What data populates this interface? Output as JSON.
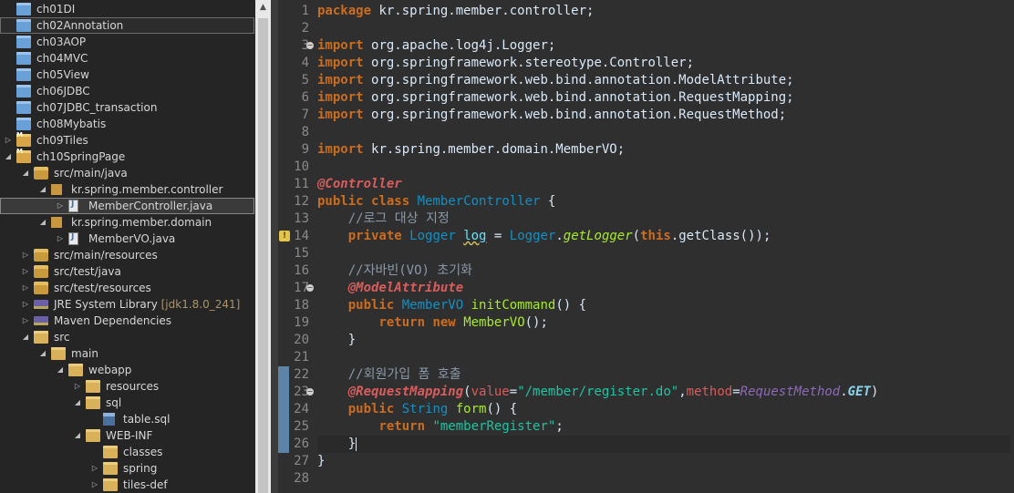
{
  "explorer": {
    "items": [
      {
        "label": "ch01DI",
        "level": 1,
        "icon": "project-folder-icon",
        "expanded": null
      },
      {
        "label": "ch02Annotation",
        "level": 1,
        "icon": "project-folder-icon",
        "expanded": null,
        "boxed": true
      },
      {
        "label": "ch03AOP",
        "level": 1,
        "icon": "project-folder-icon",
        "expanded": null
      },
      {
        "label": "ch04MVC",
        "level": 1,
        "icon": "project-folder-icon",
        "expanded": null
      },
      {
        "label": "ch05View",
        "level": 1,
        "icon": "project-folder-icon",
        "expanded": null
      },
      {
        "label": "ch06JDBC",
        "level": 1,
        "icon": "project-folder-icon",
        "expanded": null
      },
      {
        "label": "ch07JDBC_transaction",
        "level": 1,
        "icon": "project-folder-icon",
        "expanded": null
      },
      {
        "label": "ch08Mybatis",
        "level": 1,
        "icon": "project-folder-icon",
        "expanded": null
      },
      {
        "label": "ch09Tiles",
        "level": 1,
        "icon": "maven-project-icon",
        "expanded": false
      },
      {
        "label": "ch10SpringPage",
        "level": 1,
        "icon": "maven-project-icon",
        "expanded": true
      },
      {
        "label": "src/main/java",
        "level": 2,
        "icon": "source-folder-icon",
        "expanded": true
      },
      {
        "label": "kr.spring.member.controller",
        "level": 3,
        "icon": "package-icon",
        "expanded": true
      },
      {
        "label": "MemberController.java",
        "level": 4,
        "icon": "java-file-icon",
        "expanded": false,
        "selected": true
      },
      {
        "label": "kr.spring.member.domain",
        "level": 3,
        "icon": "package-icon",
        "expanded": true
      },
      {
        "label": "MemberVO.java",
        "level": 4,
        "icon": "java-file-icon",
        "expanded": false
      },
      {
        "label": "src/main/resources",
        "level": 2,
        "icon": "source-folder-icon",
        "expanded": false
      },
      {
        "label": "src/test/java",
        "level": 2,
        "icon": "source-folder-icon",
        "expanded": false
      },
      {
        "label": "src/test/resources",
        "level": 2,
        "icon": "source-folder-icon",
        "expanded": false
      },
      {
        "label": "JRE System Library",
        "decoration": "[jdk1.8.0_241]",
        "level": 2,
        "icon": "library-icon",
        "expanded": false
      },
      {
        "label": "Maven Dependencies",
        "level": 2,
        "icon": "library-icon",
        "expanded": false
      },
      {
        "label": "src",
        "level": 2,
        "icon": "folder-icon",
        "expanded": true
      },
      {
        "label": "main",
        "level": 3,
        "icon": "folder-icon",
        "expanded": true
      },
      {
        "label": "webapp",
        "level": 4,
        "icon": "folder-icon",
        "expanded": true
      },
      {
        "label": "resources",
        "level": 5,
        "icon": "folder-icon",
        "expanded": false
      },
      {
        "label": "sql",
        "level": 5,
        "icon": "folder-icon",
        "expanded": true
      },
      {
        "label": "table.sql",
        "level": 6,
        "icon": "sql-file-icon",
        "expanded": null
      },
      {
        "label": "WEB-INF",
        "level": 5,
        "icon": "folder-icon",
        "expanded": true
      },
      {
        "label": "classes",
        "level": 6,
        "icon": "folder-icon",
        "expanded": null
      },
      {
        "label": "spring",
        "level": 6,
        "icon": "folder-icon",
        "expanded": false
      },
      {
        "label": "tiles-def",
        "level": 6,
        "icon": "folder-icon",
        "expanded": false
      }
    ]
  },
  "editor": {
    "current_line": 26,
    "change_ranges": [
      [
        22,
        26
      ]
    ],
    "fold_lines": [
      3,
      17,
      23
    ],
    "warning_line": 14,
    "lines": [
      [
        [
          "kw",
          "package"
        ],
        [
          "",
          "kr.spring.member.controller;"
        ]
      ],
      [],
      [
        [
          "kw",
          "import"
        ],
        [
          "",
          "org.apache.log4j.Logger;"
        ]
      ],
      [
        [
          "kw",
          "import"
        ],
        [
          "",
          "org.springframework.stereotype.Controller;"
        ]
      ],
      [
        [
          "kw",
          "import"
        ],
        [
          "",
          "org.springframework.web.bind.annotation.ModelAttribute;"
        ]
      ],
      [
        [
          "kw",
          "import"
        ],
        [
          "",
          "org.springframework.web.bind.annotation.RequestMapping;"
        ]
      ],
      [
        [
          "kw",
          "import"
        ],
        [
          "",
          "org.springframework.web.bind.annotation.RequestMethod;"
        ]
      ],
      [],
      [
        [
          "kw",
          "import"
        ],
        [
          "",
          "kr.spring.member.domain.MemberVO;"
        ]
      ],
      [],
      [
        [
          "an",
          "@Controller"
        ]
      ],
      [
        [
          "kw",
          "public"
        ],
        [
          "",
          "  "
        ],
        [
          "kw",
          "class"
        ],
        [
          "",
          ""
        ],
        [
          "ty",
          "MemberController"
        ],
        [
          "",
          " {"
        ]
      ],
      [
        [
          "",
          "    "
        ],
        [
          "cm",
          "//로그 대상 지정"
        ]
      ],
      [
        [
          "",
          "    "
        ],
        [
          "kw",
          "private"
        ],
        [
          "",
          " "
        ],
        [
          "ty",
          "Logger"
        ],
        [
          "",
          " "
        ],
        [
          "fisq",
          "log"
        ],
        [
          "",
          " = "
        ],
        [
          "ty",
          "Logger"
        ],
        [
          "",
          "."
        ],
        [
          "mei",
          "getLogger"
        ],
        [
          "",
          "("
        ],
        [
          "kw",
          "this"
        ],
        [
          "",
          ".getClass());"
        ]
      ],
      [],
      [
        [
          "",
          "    "
        ],
        [
          "cm",
          "//자바빈(VO) 초기화"
        ]
      ],
      [
        [
          "",
          "    "
        ],
        [
          "an",
          "@ModelAttribute"
        ]
      ],
      [
        [
          "",
          "    "
        ],
        [
          "kw",
          "public"
        ],
        [
          "",
          " "
        ],
        [
          "ty",
          "MemberVO"
        ],
        [
          "",
          " "
        ],
        [
          "me",
          "initCommand"
        ],
        [
          "",
          "() {"
        ]
      ],
      [
        [
          "",
          "        "
        ],
        [
          "kw",
          "return"
        ],
        [
          "",
          " "
        ],
        [
          "kw",
          "new"
        ],
        [
          "",
          " "
        ],
        [
          "me",
          "MemberVO"
        ],
        [
          "",
          "();"
        ]
      ],
      [
        [
          "",
          "    }"
        ]
      ],
      [],
      [
        [
          "",
          "    "
        ],
        [
          "cm",
          "//회원가입 폼 호출"
        ]
      ],
      [
        [
          "",
          "    "
        ],
        [
          "an",
          "@RequestMapping"
        ],
        [
          "",
          "("
        ],
        [
          "at",
          "value"
        ],
        [
          "",
          "="
        ],
        [
          "st",
          "\"/member/register.do\""
        ],
        [
          "",
          ","
        ],
        [
          "at",
          "method"
        ],
        [
          "",
          "="
        ],
        [
          "ae",
          "RequestMethod"
        ],
        [
          "",
          "."
        ],
        [
          "ec",
          "GET"
        ],
        [
          "",
          ")"
        ]
      ],
      [
        [
          "",
          "    "
        ],
        [
          "kw",
          "public"
        ],
        [
          "",
          " "
        ],
        [
          "ty",
          "String"
        ],
        [
          "",
          " "
        ],
        [
          "me",
          "form"
        ],
        [
          "",
          "() {"
        ]
      ],
      [
        [
          "",
          "        "
        ],
        [
          "kw",
          "return"
        ],
        [
          "",
          " "
        ],
        [
          "st",
          "\"memberRegister\""
        ],
        [
          "",
          ";"
        ]
      ],
      [
        [
          "",
          "    }"
        ],
        [
          "caret",
          ""
        ]
      ],
      [
        [
          "",
          "}"
        ]
      ],
      []
    ]
  }
}
